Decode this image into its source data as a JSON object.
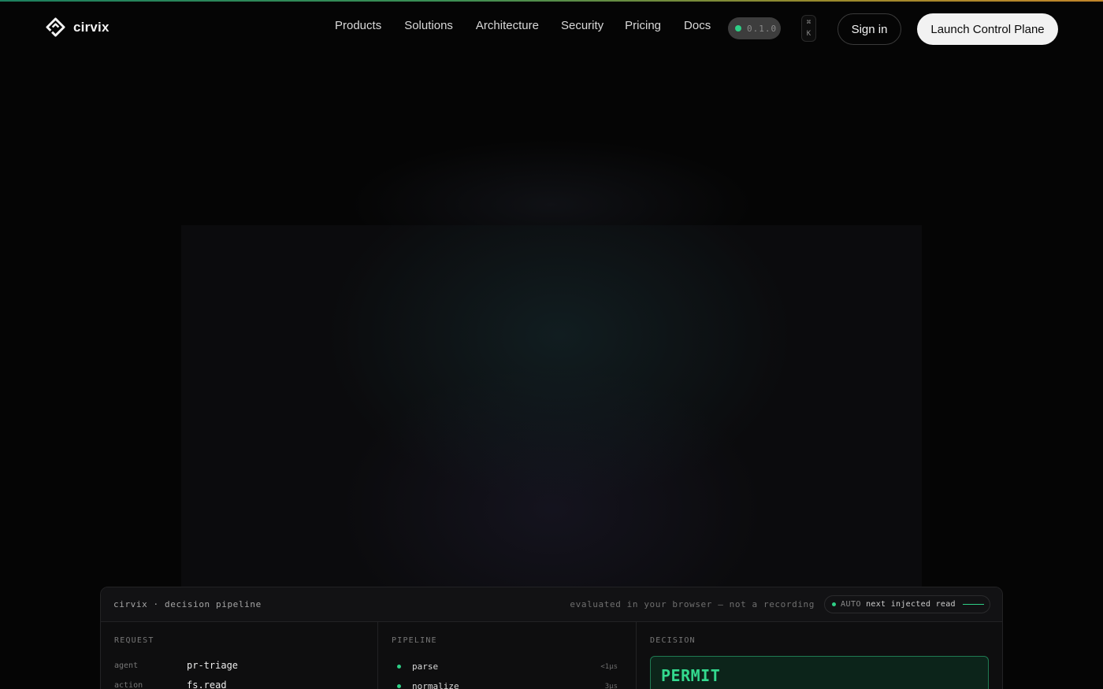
{
  "brand": {
    "name": "cirvix"
  },
  "nav": {
    "items": [
      "Products",
      "Solutions",
      "Architecture",
      "Security",
      "Pricing",
      "Docs"
    ],
    "version": "0.1.0",
    "shortcut": [
      "⌘",
      "K"
    ],
    "signin_label": "Sign in",
    "launch_label": "Launch Control Plane"
  },
  "panel": {
    "title": "cirvix · decision pipeline",
    "note": "evaluated in your browser — not a recording",
    "auto_label": "AUTO",
    "auto_next": "next injected read",
    "request": {
      "heading": "REQUEST",
      "rows": [
        {
          "key": "agent",
          "value": "pr-triage"
        },
        {
          "key": "action",
          "value": "fs.read"
        }
      ]
    },
    "pipeline": {
      "heading": "PIPELINE",
      "steps": [
        {
          "name": "parse",
          "time": "<1µs"
        },
        {
          "name": "normalize",
          "time": "3µs"
        }
      ]
    },
    "decision": {
      "heading": "DECISION",
      "value": "PERMIT"
    }
  },
  "colors": {
    "accent": "#2ecf86",
    "background": "#050505",
    "decision_border": "#1f7a52"
  },
  "icons": [
    "cirvix-logo-icon",
    "status-dot-icon"
  ]
}
